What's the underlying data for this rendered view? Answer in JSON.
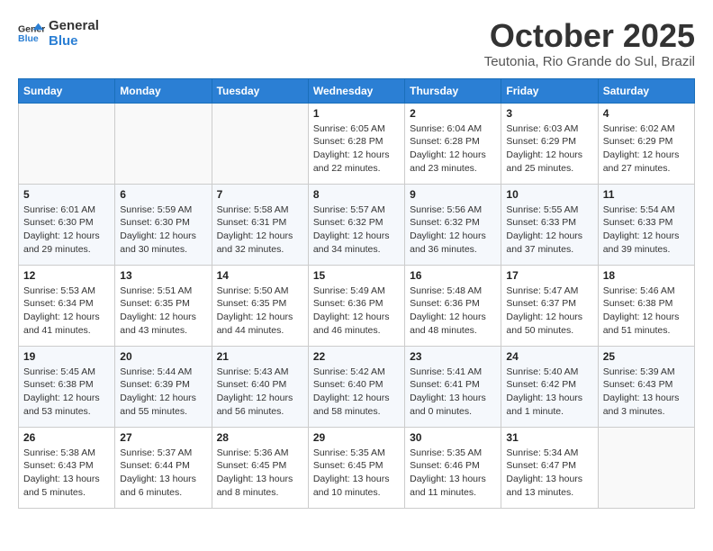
{
  "header": {
    "logo_line1": "General",
    "logo_line2": "Blue",
    "month": "October 2025",
    "location": "Teutonia, Rio Grande do Sul, Brazil"
  },
  "days_of_week": [
    "Sunday",
    "Monday",
    "Tuesday",
    "Wednesday",
    "Thursday",
    "Friday",
    "Saturday"
  ],
  "weeks": [
    [
      {
        "day": null
      },
      {
        "day": null
      },
      {
        "day": null
      },
      {
        "day": 1,
        "sunrise": "Sunrise: 6:05 AM",
        "sunset": "Sunset: 6:28 PM",
        "daylight": "Daylight: 12 hours and 22 minutes."
      },
      {
        "day": 2,
        "sunrise": "Sunrise: 6:04 AM",
        "sunset": "Sunset: 6:28 PM",
        "daylight": "Daylight: 12 hours and 23 minutes."
      },
      {
        "day": 3,
        "sunrise": "Sunrise: 6:03 AM",
        "sunset": "Sunset: 6:29 PM",
        "daylight": "Daylight: 12 hours and 25 minutes."
      },
      {
        "day": 4,
        "sunrise": "Sunrise: 6:02 AM",
        "sunset": "Sunset: 6:29 PM",
        "daylight": "Daylight: 12 hours and 27 minutes."
      }
    ],
    [
      {
        "day": 5,
        "sunrise": "Sunrise: 6:01 AM",
        "sunset": "Sunset: 6:30 PM",
        "daylight": "Daylight: 12 hours and 29 minutes."
      },
      {
        "day": 6,
        "sunrise": "Sunrise: 5:59 AM",
        "sunset": "Sunset: 6:30 PM",
        "daylight": "Daylight: 12 hours and 30 minutes."
      },
      {
        "day": 7,
        "sunrise": "Sunrise: 5:58 AM",
        "sunset": "Sunset: 6:31 PM",
        "daylight": "Daylight: 12 hours and 32 minutes."
      },
      {
        "day": 8,
        "sunrise": "Sunrise: 5:57 AM",
        "sunset": "Sunset: 6:32 PM",
        "daylight": "Daylight: 12 hours and 34 minutes."
      },
      {
        "day": 9,
        "sunrise": "Sunrise: 5:56 AM",
        "sunset": "Sunset: 6:32 PM",
        "daylight": "Daylight: 12 hours and 36 minutes."
      },
      {
        "day": 10,
        "sunrise": "Sunrise: 5:55 AM",
        "sunset": "Sunset: 6:33 PM",
        "daylight": "Daylight: 12 hours and 37 minutes."
      },
      {
        "day": 11,
        "sunrise": "Sunrise: 5:54 AM",
        "sunset": "Sunset: 6:33 PM",
        "daylight": "Daylight: 12 hours and 39 minutes."
      }
    ],
    [
      {
        "day": 12,
        "sunrise": "Sunrise: 5:53 AM",
        "sunset": "Sunset: 6:34 PM",
        "daylight": "Daylight: 12 hours and 41 minutes."
      },
      {
        "day": 13,
        "sunrise": "Sunrise: 5:51 AM",
        "sunset": "Sunset: 6:35 PM",
        "daylight": "Daylight: 12 hours and 43 minutes."
      },
      {
        "day": 14,
        "sunrise": "Sunrise: 5:50 AM",
        "sunset": "Sunset: 6:35 PM",
        "daylight": "Daylight: 12 hours and 44 minutes."
      },
      {
        "day": 15,
        "sunrise": "Sunrise: 5:49 AM",
        "sunset": "Sunset: 6:36 PM",
        "daylight": "Daylight: 12 hours and 46 minutes."
      },
      {
        "day": 16,
        "sunrise": "Sunrise: 5:48 AM",
        "sunset": "Sunset: 6:36 PM",
        "daylight": "Daylight: 12 hours and 48 minutes."
      },
      {
        "day": 17,
        "sunrise": "Sunrise: 5:47 AM",
        "sunset": "Sunset: 6:37 PM",
        "daylight": "Daylight: 12 hours and 50 minutes."
      },
      {
        "day": 18,
        "sunrise": "Sunrise: 5:46 AM",
        "sunset": "Sunset: 6:38 PM",
        "daylight": "Daylight: 12 hours and 51 minutes."
      }
    ],
    [
      {
        "day": 19,
        "sunrise": "Sunrise: 5:45 AM",
        "sunset": "Sunset: 6:38 PM",
        "daylight": "Daylight: 12 hours and 53 minutes."
      },
      {
        "day": 20,
        "sunrise": "Sunrise: 5:44 AM",
        "sunset": "Sunset: 6:39 PM",
        "daylight": "Daylight: 12 hours and 55 minutes."
      },
      {
        "day": 21,
        "sunrise": "Sunrise: 5:43 AM",
        "sunset": "Sunset: 6:40 PM",
        "daylight": "Daylight: 12 hours and 56 minutes."
      },
      {
        "day": 22,
        "sunrise": "Sunrise: 5:42 AM",
        "sunset": "Sunset: 6:40 PM",
        "daylight": "Daylight: 12 hours and 58 minutes."
      },
      {
        "day": 23,
        "sunrise": "Sunrise: 5:41 AM",
        "sunset": "Sunset: 6:41 PM",
        "daylight": "Daylight: 13 hours and 0 minutes."
      },
      {
        "day": 24,
        "sunrise": "Sunrise: 5:40 AM",
        "sunset": "Sunset: 6:42 PM",
        "daylight": "Daylight: 13 hours and 1 minute."
      },
      {
        "day": 25,
        "sunrise": "Sunrise: 5:39 AM",
        "sunset": "Sunset: 6:43 PM",
        "daylight": "Daylight: 13 hours and 3 minutes."
      }
    ],
    [
      {
        "day": 26,
        "sunrise": "Sunrise: 5:38 AM",
        "sunset": "Sunset: 6:43 PM",
        "daylight": "Daylight: 13 hours and 5 minutes."
      },
      {
        "day": 27,
        "sunrise": "Sunrise: 5:37 AM",
        "sunset": "Sunset: 6:44 PM",
        "daylight": "Daylight: 13 hours and 6 minutes."
      },
      {
        "day": 28,
        "sunrise": "Sunrise: 5:36 AM",
        "sunset": "Sunset: 6:45 PM",
        "daylight": "Daylight: 13 hours and 8 minutes."
      },
      {
        "day": 29,
        "sunrise": "Sunrise: 5:35 AM",
        "sunset": "Sunset: 6:45 PM",
        "daylight": "Daylight: 13 hours and 10 minutes."
      },
      {
        "day": 30,
        "sunrise": "Sunrise: 5:35 AM",
        "sunset": "Sunset: 6:46 PM",
        "daylight": "Daylight: 13 hours and 11 minutes."
      },
      {
        "day": 31,
        "sunrise": "Sunrise: 5:34 AM",
        "sunset": "Sunset: 6:47 PM",
        "daylight": "Daylight: 13 hours and 13 minutes."
      },
      {
        "day": null
      }
    ]
  ]
}
